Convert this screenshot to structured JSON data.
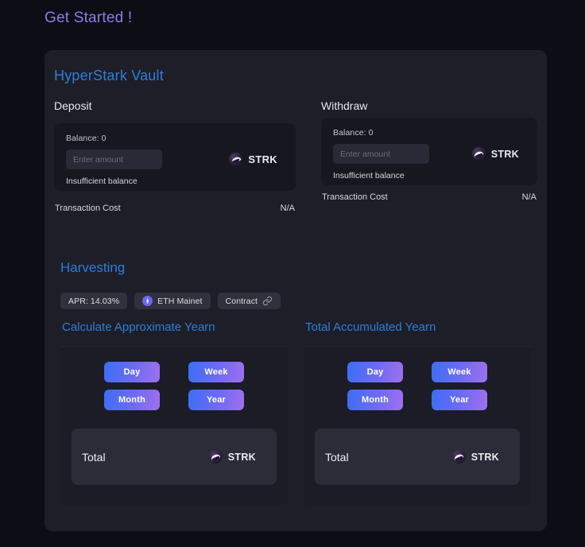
{
  "page": {
    "title": "Get Started !"
  },
  "vault": {
    "title": "HyperStark Vault",
    "deposit": {
      "heading": "Deposit",
      "balance_label": "Balance: 0",
      "input_value": "",
      "input_placeholder": "Enter amount",
      "token": "STRK",
      "token_icon": "strk-token-icon",
      "error": "Insufficient balance",
      "tx_cost_label": "Transaction Cost",
      "tx_cost_value": "N/A"
    },
    "withdraw": {
      "heading": "Withdraw",
      "balance_label": "Balance: 0",
      "input_value": "",
      "input_placeholder": "Enter amount",
      "token": "STRK",
      "token_icon": "strk-token-icon",
      "error": "Insufficient balance",
      "tx_cost_label": "Transaction Cost",
      "tx_cost_value": "N/A"
    }
  },
  "harvesting": {
    "title": "Harvesting",
    "pills": {
      "apr": "APR: 14.03%",
      "network": "ETH Mainet",
      "network_icon": "eth-icon",
      "contract": "Contract",
      "contract_icon": "link-icon"
    }
  },
  "calculate": {
    "heading": "Calculate Approximate Yearn",
    "periods": [
      "Day",
      "Week",
      "Month",
      "Year"
    ],
    "total_label": "Total",
    "total_token": "STRK",
    "total_token_icon": "strk-token-icon"
  },
  "accumulated": {
    "heading": "Total Accumulated Yearn",
    "periods": [
      "Day",
      "Week",
      "Month",
      "Year"
    ],
    "total_label": "Total",
    "total_token": "STRK",
    "total_token_icon": "strk-token-icon"
  },
  "colors": {
    "page_background": "#0d0e15",
    "panel_background": "#1d1e28",
    "accent_blue": "#2e7ddb",
    "heading_purple": "#8b7dea",
    "button_gradient_start": "#3b6ef5",
    "button_gradient_end": "#a070ef"
  }
}
